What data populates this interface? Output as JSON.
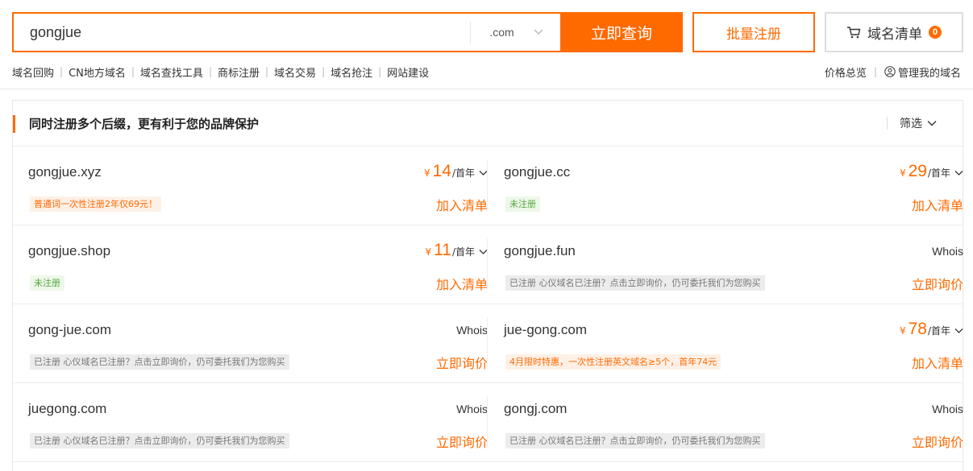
{
  "search": {
    "query": "gongjue",
    "suffix": ".com",
    "query_button": "立即查询",
    "batch_button": "批量注册",
    "list_button": "域名清单",
    "list_count": "0"
  },
  "nav": {
    "links": [
      "域名回购",
      "CN地方域名",
      "域名查找工具",
      "商标注册",
      "域名交易",
      "域名抢注",
      "网站建设"
    ],
    "right": [
      "价格总览",
      "管理我的域名"
    ]
  },
  "panel": {
    "title": "同时注册多个后缀，更有利于您的品牌保护",
    "filter_label": "筛选"
  },
  "rows": [
    [
      {
        "domain": "gongjue.xyz",
        "currency": "¥",
        "price": "14",
        "unit": "/首年",
        "tag": "普通词一次性注册2年仅69元！",
        "tag_type": "promo",
        "action": "加入清单"
      },
      {
        "domain": "gongjue.cc",
        "currency": "¥",
        "price": "29",
        "unit": "/首年",
        "tag": "未注册",
        "tag_type": "free",
        "action": "加入清单"
      }
    ],
    [
      {
        "domain": "gongjue.shop",
        "currency": "¥",
        "price": "11",
        "unit": "/首年",
        "tag": "未注册",
        "tag_type": "free",
        "action": "加入清单"
      },
      {
        "domain": "gongjue.fun",
        "whois": "Whois",
        "tag": "已注册 心仪域名已注册？点击立即询价，仍可委托我们为您购买",
        "tag_type": "taken",
        "action": "立即询价"
      }
    ],
    [
      {
        "domain": "gong-jue.com",
        "whois": "Whois",
        "tag": "已注册 心仪域名已注册？点击立即询价，仍可委托我们为您购买",
        "tag_type": "taken",
        "action": "立即询价"
      },
      {
        "domain": "jue-gong.com",
        "currency": "¥",
        "price": "78",
        "unit": "/首年",
        "tag": "4月限时特惠，一次性注册英文域名≥5个，首年74元",
        "tag_type": "promo",
        "action": "加入清单"
      }
    ],
    [
      {
        "domain": "juegong.com",
        "whois": "Whois",
        "tag": "已注册 心仪域名已注册？点击立即询价，仍可委托我们为您购买",
        "tag_type": "taken",
        "action": "立即询价"
      },
      {
        "domain": "gongj.com",
        "whois": "Whois",
        "tag": "已注册 心仪域名已注册？点击立即询价，仍可委托我们为您购买",
        "tag_type": "taken",
        "action": "立即询价"
      }
    ]
  ],
  "colors": {
    "accent": "#ff6a00",
    "free": "#52a83b",
    "taken_bg": "#ececec"
  },
  "icons": {
    "cart": "cart-icon",
    "user": "user-icon",
    "chevron": "chevron-down-icon"
  }
}
